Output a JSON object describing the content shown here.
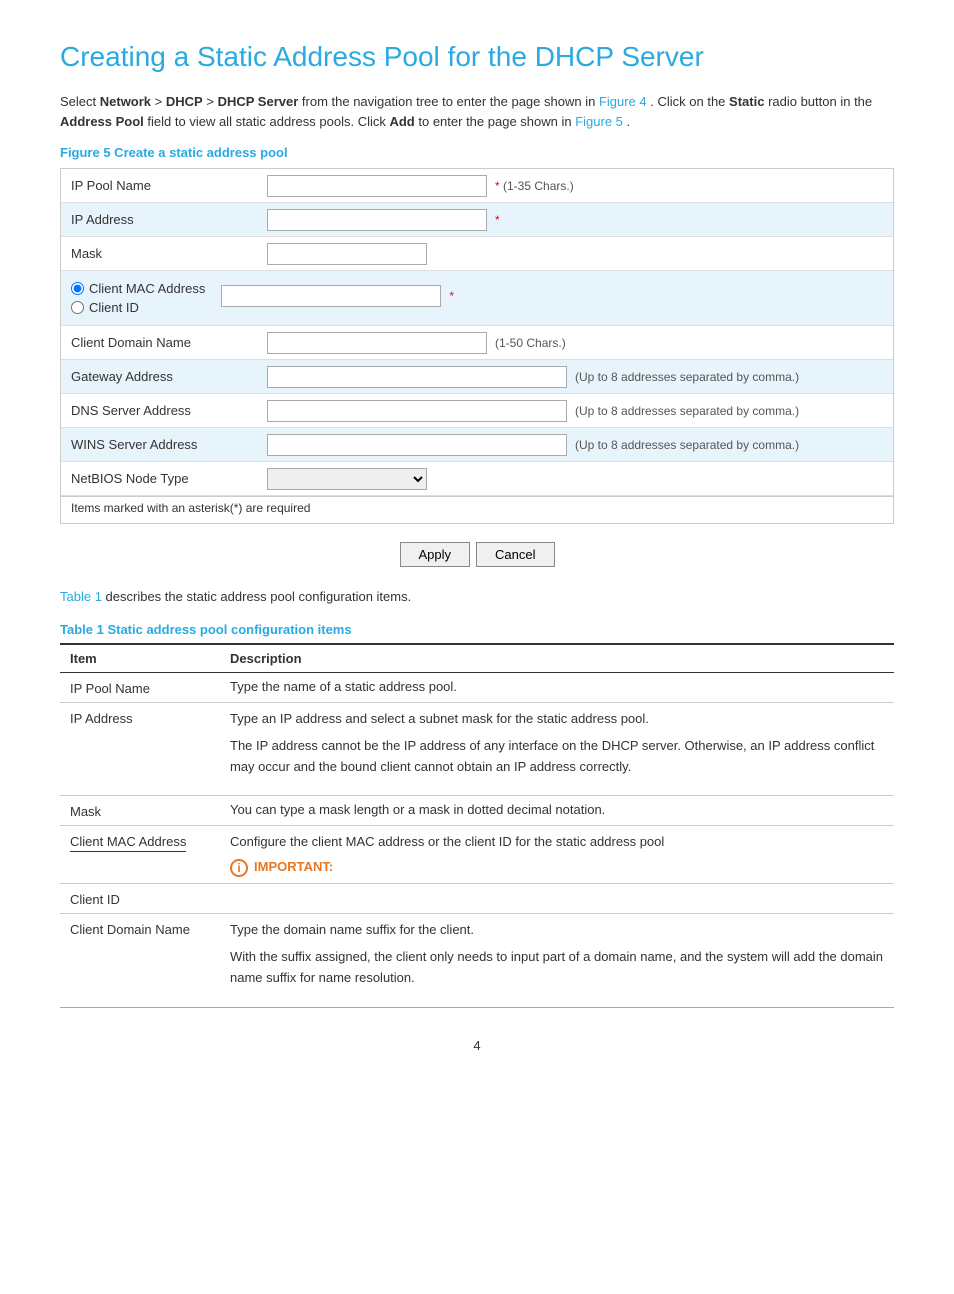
{
  "page": {
    "title": "Creating a Static Address Pool for the DHCP Server",
    "intro": {
      "text1": "Select ",
      "network": "Network",
      "gt1": " > ",
      "dhcp": "DHCP",
      "gt2": " > ",
      "dhcp_server": "DHCP Server",
      "text2": " from the navigation tree to enter the page shown in ",
      "figure4_link": "Figure 4",
      "text3": ". Click on the ",
      "static": "Static",
      "text4": " radio button in the ",
      "address_pool": "Address Pool",
      "text5": " field to view all static address pools. Click ",
      "add": "Add",
      "text6": " to enter the page shown in ",
      "figure5_link": "Figure 5",
      "text7": "."
    },
    "figure_title": "Figure 5 Create a static address pool",
    "form": {
      "rows": [
        {
          "label": "IP Pool Name",
          "input_width": "wide",
          "hint": "* (1-35 Chars.)",
          "hint_red": true,
          "shaded": false,
          "type": "input"
        },
        {
          "label": "IP Address",
          "input_width": "wide",
          "hint": "*",
          "hint_red": true,
          "shaded": true,
          "type": "input"
        },
        {
          "label": "Mask",
          "input_width": "medium",
          "hint": "",
          "shaded": false,
          "type": "input"
        },
        {
          "label": "",
          "shaded": true,
          "type": "radio",
          "options": [
            {
              "label": "Client MAC Address",
              "checked": true
            },
            {
              "label": "Client ID",
              "checked": false
            }
          ],
          "hint": "*",
          "hint_red": true
        },
        {
          "label": "Client Domain Name",
          "input_width": "wide",
          "hint": "(1-50 Chars.)",
          "shaded": false,
          "type": "input"
        },
        {
          "label": "Gateway Address",
          "input_width": "large",
          "hint": "(Up to 8 addresses separated by comma.)",
          "shaded": true,
          "type": "input"
        },
        {
          "label": "DNS Server Address",
          "input_width": "large",
          "hint": "(Up to 8 addresses separated by comma.)",
          "shaded": false,
          "type": "input"
        },
        {
          "label": "WINS Server Address",
          "input_width": "large",
          "hint": "(Up to 8 addresses separated by comma.)",
          "shaded": true,
          "type": "input"
        },
        {
          "label": "NetBIOS Node Type",
          "shaded": false,
          "type": "select"
        }
      ],
      "footer": "Items marked with an asterisk(*) are required",
      "apply_btn": "Apply",
      "cancel_btn": "Cancel"
    },
    "table_intro": " describes the static address pool configuration items.",
    "table1_link": "Table 1",
    "table_title": "Table 1 Static address pool configuration items",
    "table": {
      "headers": [
        "Item",
        "Description"
      ],
      "rows": [
        {
          "item": "IP Pool Name",
          "description": "Type the name of a static address pool."
        },
        {
          "item": "IP Address",
          "description": "Type an IP address and select a subnet mask for the static address pool.\nThe IP address cannot be the IP address of any interface on the DHCP server. Otherwise, an IP address conflict may occur and the bound client cannot obtain an IP address correctly."
        },
        {
          "item": "Mask",
          "description": "You can type a mask length or a mask in dotted decimal notation."
        },
        {
          "item": "Client MAC Address",
          "description": "Configure the client MAC address or the client ID for the static address pool",
          "important": "IMPORTANT:",
          "has_important": true
        },
        {
          "item": "Client ID",
          "description": ""
        },
        {
          "item": "Client Domain Name",
          "description": "Type the domain name suffix for the client.\nWith the suffix assigned, the client only needs to input part of a domain name, and the system will add the domain name suffix for name resolution."
        }
      ]
    },
    "page_number": "4"
  }
}
